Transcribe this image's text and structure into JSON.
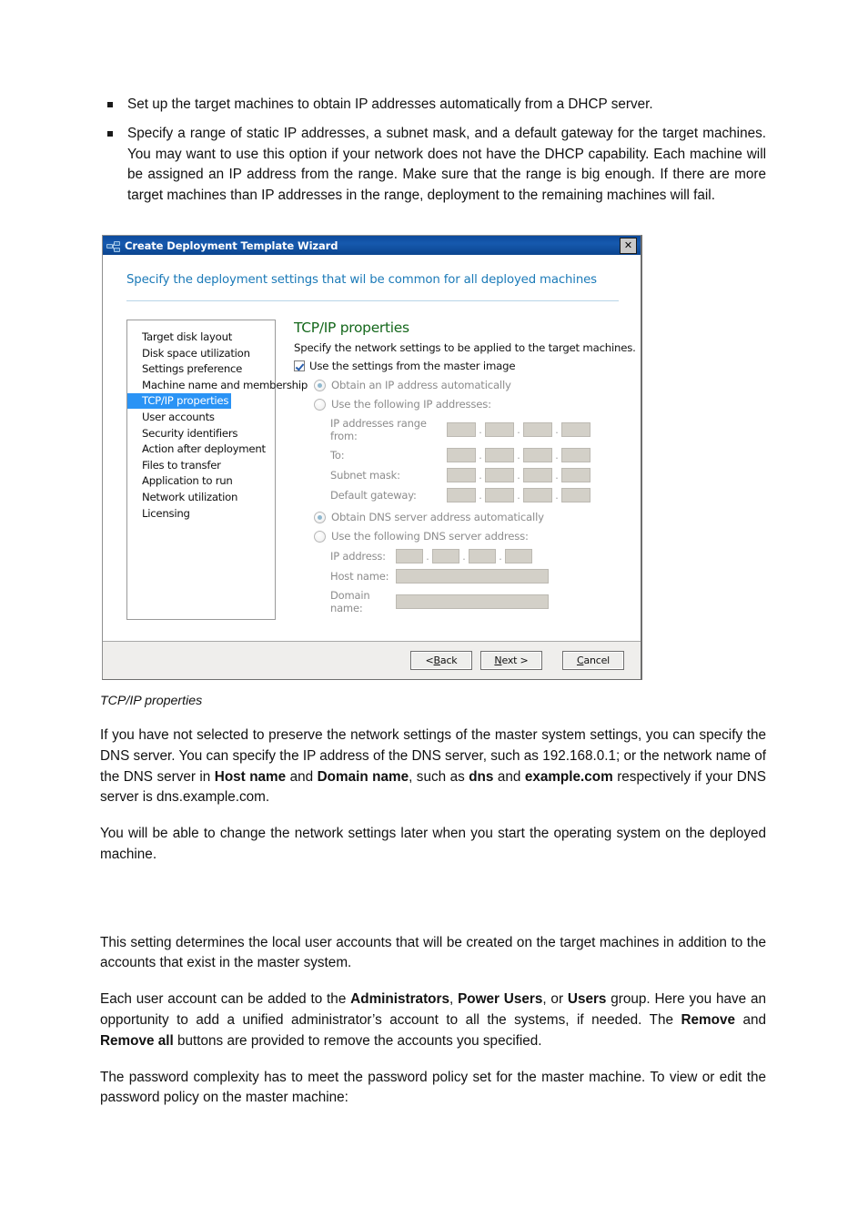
{
  "document": {
    "bullets": [
      "Set up the target machines to obtain IP addresses automatically from a DHCP server.",
      "Specify a range of static IP addresses, a subnet mask, and a default gateway for the target machines. You may want to use this option if your network does not have the DHCP capability. Each machine will be assigned an IP address from the range. Make sure that the range is big enough. If there are more target machines than IP addresses in the range, deployment to the remaining machines will fail."
    ],
    "figure_caption": "TCP/IP properties",
    "paragraphs": {
      "dns_p1_a": "If you have not selected to preserve the network settings of the master system settings, you can specify the DNS server. You can specify the IP address of the DNS server, such as 192.168.0.1; or the network name of the DNS server in ",
      "dns_p1_bold1": "Host name",
      "dns_p1_b": " and ",
      "dns_p1_bold2": "Domain name",
      "dns_p1_c": ", such as ",
      "dns_p1_bold3": "dns",
      "dns_p1_d": " and ",
      "dns_p1_bold4": "example.com",
      "dns_p1_e": " respectively if your DNS server is dns.example.com.",
      "dns_p2": "You will be able to change the network settings later when you start the operating system on the deployed machine.",
      "accounts_p1": "This setting determines the local user accounts that will be created on the target machines in addition to the accounts that exist in the master system.",
      "accounts_p2_a": "Each user account can be added to the ",
      "accounts_p2_bold1": "Administrators",
      "accounts_p2_b": ", ",
      "accounts_p2_bold2": "Power Users",
      "accounts_p2_c": ", or ",
      "accounts_p2_bold3": "Users",
      "accounts_p2_d": " group. Here you have an opportunity to add a unified administrator’s account to all the systems, if needed. The ",
      "accounts_p2_bold4": "Remove",
      "accounts_p2_e": " and ",
      "accounts_p2_bold5": "Remove all",
      "accounts_p2_f": " buttons are provided to remove the accounts you specified.",
      "accounts_p3": "The password complexity has to meet the password policy set for the master machine. To view or edit the password policy on the master machine:"
    }
  },
  "dialog": {
    "title": "Create Deployment Template Wizard",
    "title_icon": "network-computers-icon",
    "close_label": "✕",
    "banner": "Specify the deployment settings that wil be common for all deployed machines",
    "steps": [
      {
        "label": "Target disk layout",
        "selected": false
      },
      {
        "label": "Disk space utilization",
        "selected": false
      },
      {
        "label": "Settings preference",
        "selected": false
      },
      {
        "label": "Machine name and membership",
        "selected": false
      },
      {
        "label": "TCP/IP properties",
        "selected": true
      },
      {
        "label": "User accounts",
        "selected": false
      },
      {
        "label": "Security identifiers",
        "selected": false
      },
      {
        "label": "Action after deployment",
        "selected": false
      },
      {
        "label": "Files to transfer",
        "selected": false
      },
      {
        "label": "Application to run",
        "selected": false
      },
      {
        "label": "Network utilization",
        "selected": false
      },
      {
        "label": "Licensing",
        "selected": false
      }
    ],
    "content": {
      "title": "TCP/IP properties",
      "subtitle": "Specify the network settings to be applied to the target machines.",
      "master_image_checkbox": "Use the settings from the master image",
      "radio_obtain_ip": "Obtain an IP address automatically",
      "radio_static_ip": "Use the following IP addresses:",
      "label_range_from": "IP addresses range from:",
      "label_to": "To:",
      "label_subnet": "Subnet mask:",
      "label_gateway": "Default gateway:",
      "radio_obtain_dns": "Obtain DNS server address automatically",
      "radio_static_dns": "Use the following DNS server address:",
      "label_dns_ip": "IP address:",
      "label_host_name": "Host name:",
      "label_domain_name": "Domain name:",
      "octet_value": "",
      "host_name_value": "",
      "domain_name_value": "",
      "separator": "."
    },
    "buttons": {
      "back_pre": "< ",
      "back_mnemonic": "B",
      "back_post": "ack",
      "next_mnemonic": "N",
      "next_post": "ext >",
      "cancel_mnemonic": "C",
      "cancel_post": "ancel"
    },
    "colors": {
      "titlebar": "#0c4a9c",
      "banner_text": "#1b7ab8",
      "content_title": "#15681c",
      "selection": "#2a93f5",
      "field_fill": "#d3d0c8"
    }
  }
}
